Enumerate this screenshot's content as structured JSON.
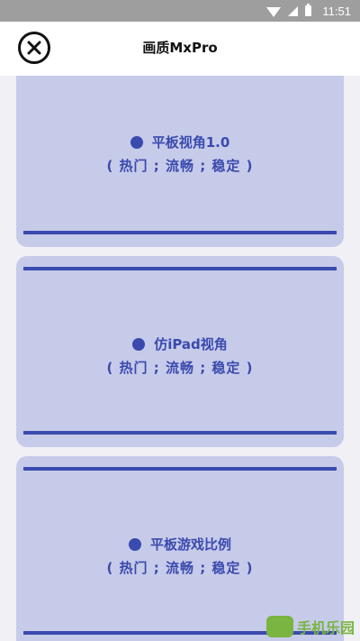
{
  "status_bar": {
    "time": "11:51"
  },
  "header": {
    "title": "画质MxPro"
  },
  "cards": [
    {
      "title": "平板视角1.0",
      "subtitle": "( 热门 ; 流畅 ; 稳定 )"
    },
    {
      "title": "仿iPad视角",
      "subtitle": "( 热门 ; 流畅 ; 稳定 )"
    },
    {
      "title": "平板游戏比例",
      "subtitle": "( 热门 ; 流畅 ; 稳定 )"
    }
  ],
  "colors": {
    "accent": "#3a4aad",
    "card_bg": "#c7cbea",
    "page_bg": "#f0f0f5",
    "status_bar": "#9e9e9e"
  },
  "watermark": {
    "text": "手机乐园"
  }
}
